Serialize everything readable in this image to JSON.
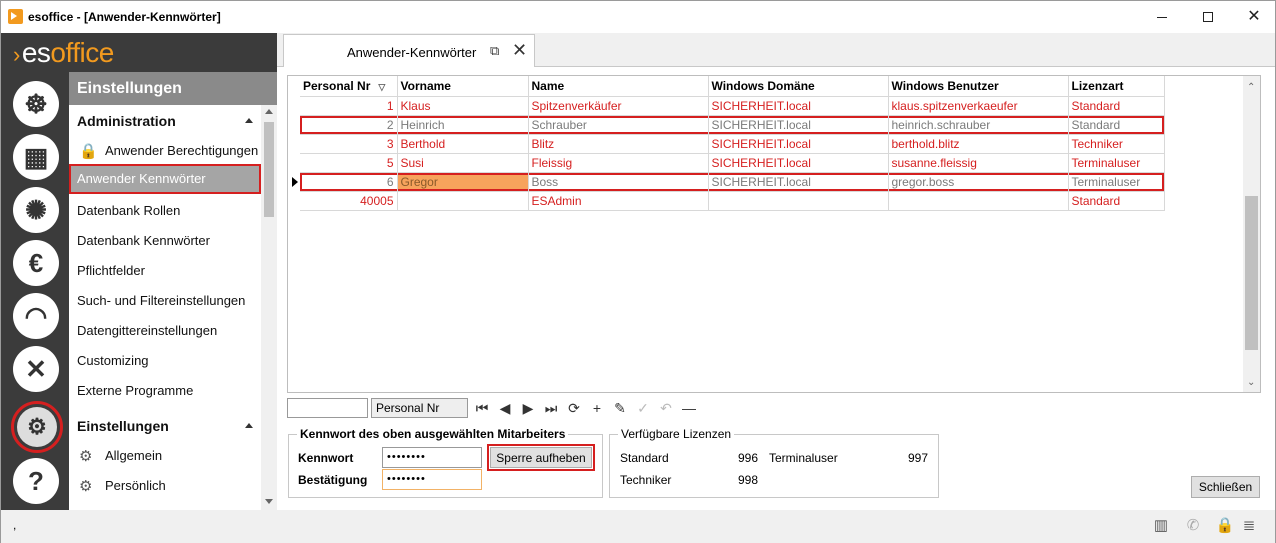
{
  "window": {
    "title": "esoffice - [Anwender-Kennwörter]"
  },
  "logo": {
    "text_es": "es",
    "text_office": "office"
  },
  "rail": [
    "helm-icon",
    "abacus-icon",
    "alarm-light-icon",
    "euro-icon",
    "headset-icon",
    "tools-icon",
    "gears-icon",
    "help-icon"
  ],
  "nav": {
    "header": "Einstellungen",
    "group1": "Administration",
    "items1": [
      "Anwender Berechtigungen",
      "Anwender Kennwörter",
      "Datenbank Rollen",
      "Datenbank Kennwörter",
      "Pflichtfelder",
      "Such- und Filtereinstellungen",
      "Datengittereinstellungen",
      "Customizing",
      "Externe Programme"
    ],
    "group2": "Einstellungen",
    "items2": [
      "Allgemein",
      "Persönlich"
    ]
  },
  "tab": {
    "label": "Anwender-Kennwörter"
  },
  "grid": {
    "columns": [
      "Personal Nr",
      "Vorname",
      "Name",
      "Windows Domäne",
      "Windows Benutzer",
      "Lizenzart"
    ],
    "rows": [
      [
        "1",
        "Klaus",
        "Spitzenverkäufer",
        "SICHERHEIT.local",
        "klaus.spitzenverkaeufer",
        "Standard"
      ],
      [
        "2",
        "Heinrich",
        "Schrauber",
        "SICHERHEIT.local",
        "heinrich.schrauber",
        "Standard"
      ],
      [
        "3",
        "Berthold",
        "Blitz",
        "SICHERHEIT.local",
        "berthold.blitz",
        "Techniker"
      ],
      [
        "5",
        "Susi",
        "Fleissig",
        "SICHERHEIT.local",
        "susanne.fleissig",
        "Terminaluser"
      ],
      [
        "6",
        "Gregor",
        "Boss",
        "SICHERHEIT.local",
        "gregor.boss",
        "Terminaluser"
      ],
      [
        "40005",
        "",
        "ESAdmin",
        "",
        "",
        "Standard"
      ]
    ]
  },
  "navigator": {
    "field": "Personal Nr"
  },
  "password_box": {
    "legend": "Kennwort des oben ausgewählten Mitarbeiters",
    "label_password": "Kennwort",
    "label_confirm": "Bestätigung",
    "password_value": "••••••••",
    "confirm_value": "••••••••",
    "unlock_button": "Sperre aufheben"
  },
  "licenses": {
    "legend": "Verfügbare Lizenzen",
    "standard_label": "Standard",
    "standard_value": "996",
    "terminal_label": "Terminaluser",
    "terminal_value": "997",
    "techniker_label": "Techniker",
    "techniker_value": "998"
  },
  "close_button": "Schließen",
  "status": {
    "text": ","
  },
  "colors": {
    "accent": "#f29a1f",
    "highlight": "#d51f1f",
    "rail": "#3b3b3b"
  }
}
